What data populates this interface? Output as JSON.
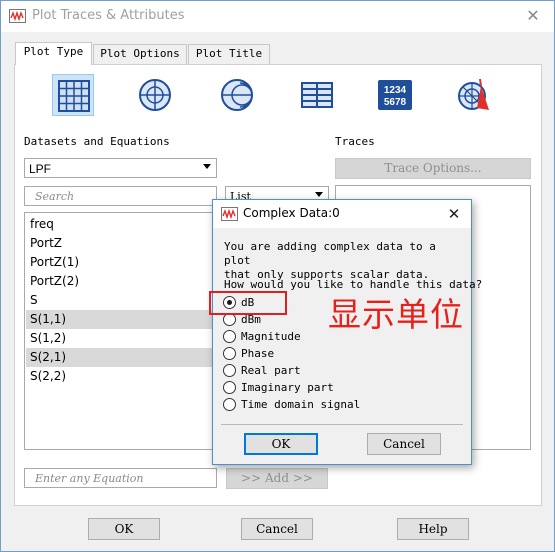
{
  "window": {
    "title": "Plot Traces & Attributes",
    "close_glyph": "✕"
  },
  "tabs": [
    {
      "label": "Plot Type",
      "active": true
    },
    {
      "label": "Plot Options",
      "active": false
    },
    {
      "label": "Plot Title",
      "active": false
    }
  ],
  "plot_types": [
    {
      "icon": "rectangular-grid-icon",
      "selected": true
    },
    {
      "icon": "polar-plot-icon",
      "selected": false
    },
    {
      "icon": "smith-chart-icon",
      "selected": false
    },
    {
      "icon": "list-table-icon",
      "selected": false
    },
    {
      "icon": "numeric-display-icon",
      "text_line1": "1234",
      "text_line2": "5678",
      "selected": false
    },
    {
      "icon": "antenna-plot-icon",
      "selected": false
    }
  ],
  "datasets": {
    "label": "Datasets and Equations",
    "selected": "LPF",
    "search_placeholder": "Search",
    "view_mode": "List",
    "items": [
      "freq",
      "PortZ",
      "PortZ(1)",
      "PortZ(2)",
      "S",
      "S(1,1)",
      "S(1,2)",
      "S(2,1)",
      "S(2,2)"
    ],
    "highlighted": [
      5,
      7
    ],
    "equation_placeholder": "Enter any Equation",
    "add_button": ">> Add >>"
  },
  "traces": {
    "label": "Traces",
    "options_button": "Trace Options..."
  },
  "footer": {
    "ok": "OK",
    "cancel": "Cancel",
    "help": "Help"
  },
  "modal": {
    "title": "Complex Data:0",
    "close_glyph": "✕",
    "message": "You are adding complex data to a plot\nthat only supports scalar data.",
    "question": "How would you like to handle this data?",
    "options": [
      "dB",
      "dBm",
      "Magnitude",
      "Phase",
      "Real part",
      "Imaginary part",
      "Time domain signal"
    ],
    "selected_index": 0,
    "ok": "OK",
    "cancel": "Cancel"
  },
  "annotation": {
    "text": "显示单位",
    "color": "#e8201c"
  },
  "colors": {
    "accent": "#0078d7",
    "selection": "#cce4f7",
    "icon_blue": "#1f4e9c"
  }
}
